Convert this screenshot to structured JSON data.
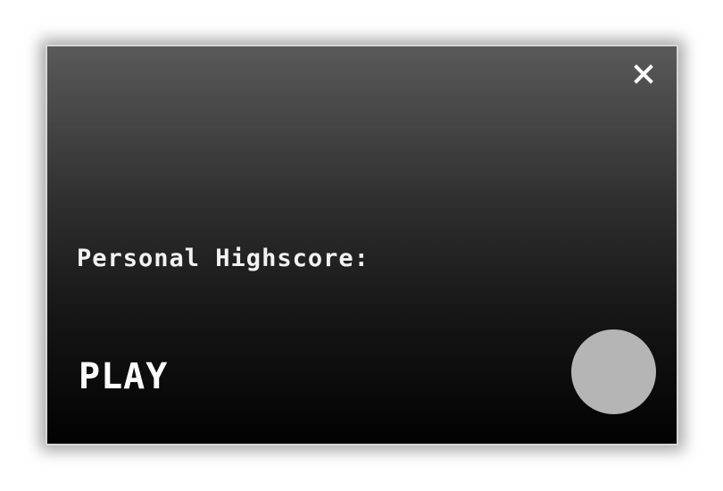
{
  "dialog": {
    "highscore_label": "Personal Highscore:",
    "play_label": "PLAY",
    "close_icon": "close-x-icon"
  },
  "colors": {
    "text": "#ffffff",
    "border": "#d6d6d6",
    "round_button": "#b5b5b5"
  }
}
